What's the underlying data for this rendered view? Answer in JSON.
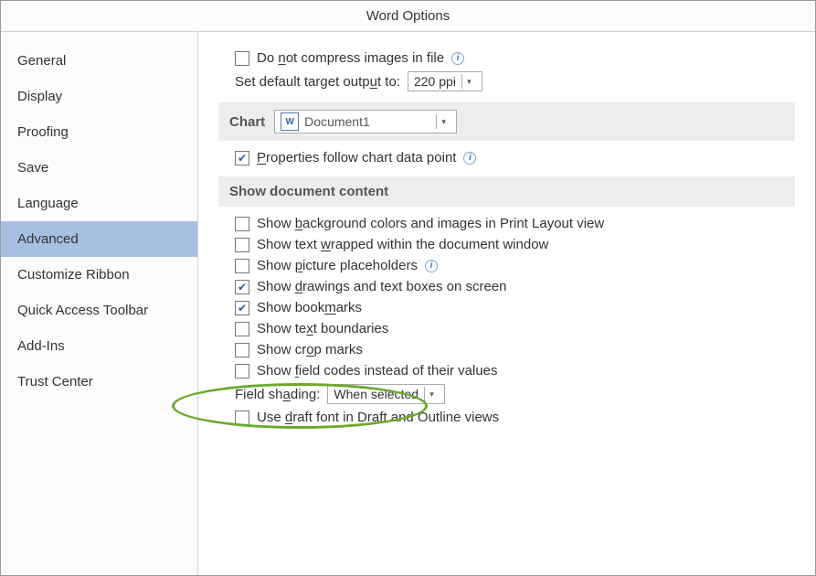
{
  "title": "Word Options",
  "sidebar": {
    "items": [
      "General",
      "Display",
      "Proofing",
      "Save",
      "Language",
      "Advanced",
      "Customize Ribbon",
      "Quick Access Toolbar",
      "Add-Ins",
      "Trust Center"
    ],
    "selected": "Advanced"
  },
  "content": {
    "compress_pre": "Do ",
    "compress_u": "n",
    "compress_post": "ot compress images in file",
    "target_pre": "Set default target outp",
    "target_u": "u",
    "target_post": "t to:",
    "target_value": "220 ppi",
    "chart_label": "Chart",
    "chart_doc": "Document1",
    "prop_u": "P",
    "prop_post": "roperties follow chart data point",
    "section_show": "Show document content",
    "opt1_pre": "Show ",
    "opt1_u": "b",
    "opt1_post": "ackground colors and images in Print Layout view",
    "opt2_pre": "Show text ",
    "opt2_u": "w",
    "opt2_post": "rapped within the document window",
    "opt3_pre": "Show ",
    "opt3_u": "p",
    "opt3_post": "icture placeholders",
    "opt4_pre": "Show ",
    "opt4_u": "d",
    "opt4_post": "rawings and text boxes on screen",
    "opt5_pre": "Show book",
    "opt5_u": "m",
    "opt5_post": "arks",
    "opt6_pre": "Show te",
    "opt6_u": "x",
    "opt6_post": "t boundaries",
    "opt7_pre": "Show cr",
    "opt7_u": "o",
    "opt7_post": "p marks",
    "opt8_pre": "Show ",
    "opt8_u": "f",
    "opt8_post": "ield codes instead of their values",
    "shading_pre": "Field sh",
    "shading_u": "a",
    "shading_post": "ding:",
    "shading_value": "When selected",
    "opt9_pre": "Use ",
    "opt9_u": "d",
    "opt9_post": "raft font in Draft and Outline views"
  }
}
